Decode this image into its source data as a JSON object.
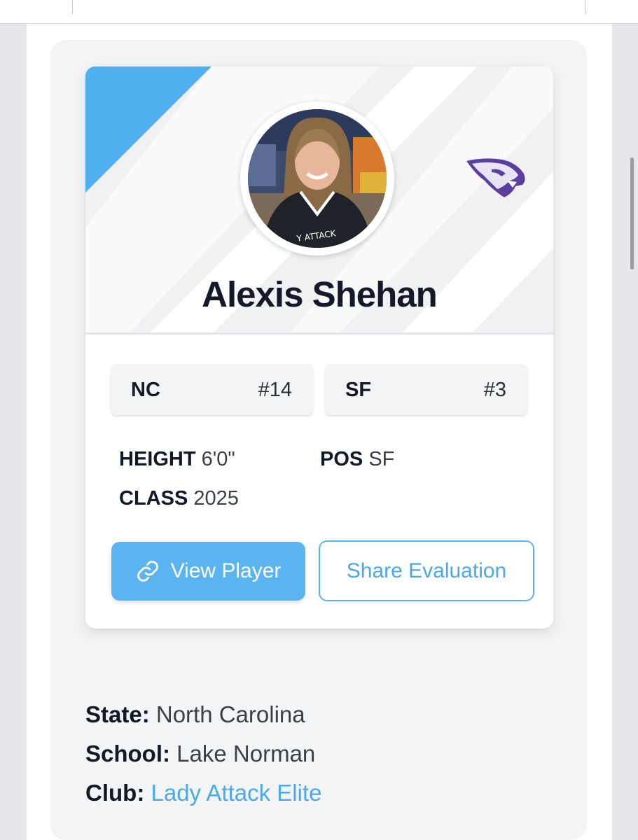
{
  "player": {
    "name": "Alexis Shehan",
    "photo_alt": "Player photo",
    "team_logo": "panther-mascot-logo"
  },
  "rankings": [
    {
      "label": "NC",
      "value": "#14"
    },
    {
      "label": "SF",
      "value": "#3"
    }
  ],
  "attributes": {
    "height_label": "HEIGHT",
    "height_value": "6'0\"",
    "pos_label": "POS",
    "pos_value": "SF",
    "class_label": "CLASS",
    "class_value": "2025"
  },
  "actions": {
    "view_player": "View Player",
    "share_evaluation": "Share Evaluation"
  },
  "details": {
    "state_label": "State:",
    "state_value": "North Carolina",
    "school_label": "School:",
    "school_value": "Lake Norman",
    "club_label": "Club:",
    "club_value": "Lady Attack Elite"
  },
  "colors": {
    "accent": "#5ab4f1",
    "link": "#4aaaf0",
    "mascot": "#5b3ea0"
  }
}
